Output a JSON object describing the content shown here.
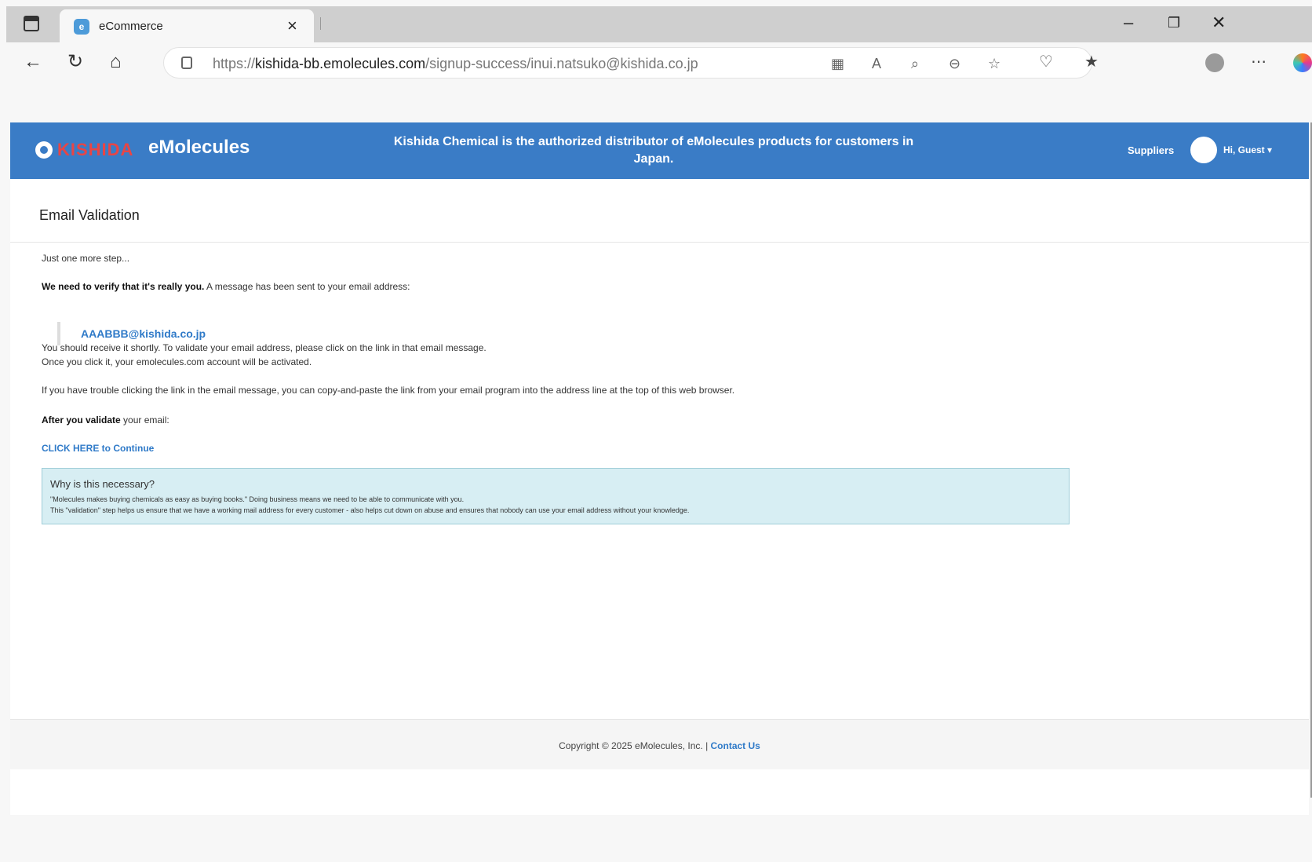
{
  "browser": {
    "tab_title": "eCommerce",
    "tab_favicon_letter": "e",
    "url_scheme": "https://",
    "url_domain": "kishida-bb.emolecules.com",
    "url_path": "/signup-success/inui.natsuko@kishida.co.jp"
  },
  "header": {
    "logo_brand": "KISHIDA",
    "logo_product": "eMolecules",
    "message": "Kishida Chemical is the authorized distributor of eMolecules products for customers in Japan.",
    "suppliers_label": "Suppliers",
    "user_label": "Hi, Guest ▾"
  },
  "page": {
    "title": "Email Validation",
    "step_text": "Just one more step...",
    "verify_bold": "We need to verify that it's really you.",
    "verify_rest": " A message has been sent to your email address:",
    "email": "AAABBB@kishida.co.jp",
    "receive_line1": "You should receive it shortly. To validate your email address, please click on the link in that email message.",
    "receive_line2": "Once you click it, your emolecules.com account will be activated.",
    "trouble_text": "If you have trouble clicking the link in the email message, you can copy-and-paste the link from your email program into the address line at the top of this web browser.",
    "after_bold": "After you validate",
    "after_rest": " your email:",
    "continue_link": "CLICK HERE to Continue"
  },
  "why_box": {
    "title": "Why is this necessary?",
    "line1": "\"Molecules makes buying chemicals as easy as buying books.\" Doing business means we need to be able to communicate with you.",
    "line2": "This \"validation\" step helps us ensure that we have a working mail address for every customer - also helps cut down on abuse and ensures that nobody can use your email address without your knowledge."
  },
  "footer": {
    "copyright": "Copyright © 2025 eMolecules, Inc. | ",
    "contact_link": "Contact Us"
  },
  "colors": {
    "header_blue": "#3a7cc6",
    "link_blue": "#2f7ac8",
    "info_box_bg": "#d7eef3"
  }
}
